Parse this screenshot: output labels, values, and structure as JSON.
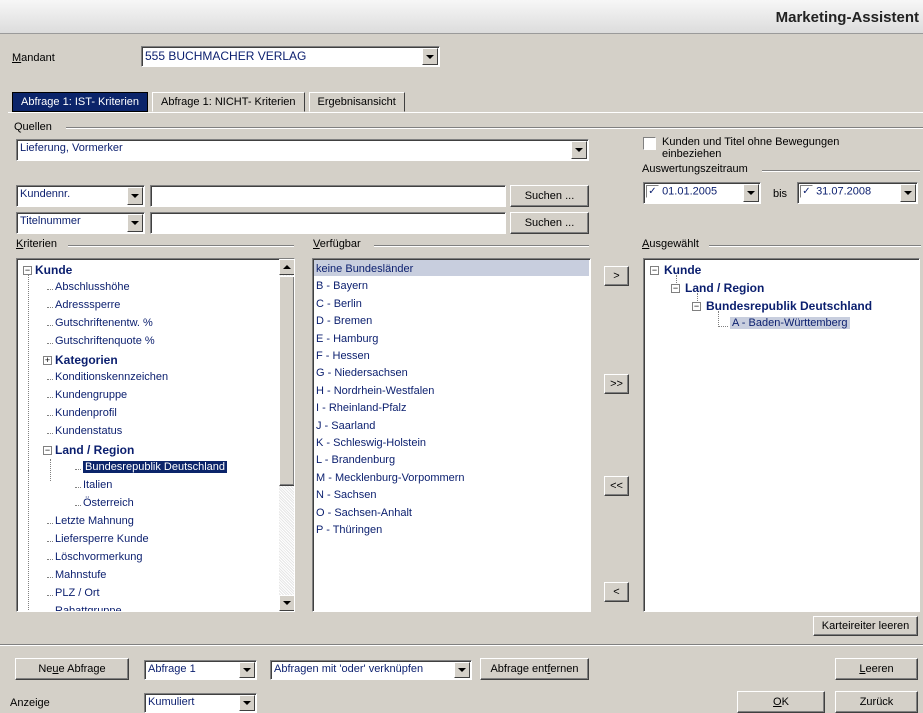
{
  "window": {
    "title": "Marketing-Assistent"
  },
  "mandant": {
    "label": "Mandant",
    "value": "555  BUCHMACHER VERLAG"
  },
  "tabs": [
    {
      "label": "Abfrage 1:  IST- Kriterien",
      "active": true
    },
    {
      "label": "Abfrage 1:  NICHT- Kriterien",
      "active": false
    },
    {
      "label": "Ergebnisansicht",
      "active": false
    }
  ],
  "quellen": {
    "label": "Quellen",
    "value": "Lieferung, Vormerker"
  },
  "options": {
    "no_movement_label": "Kunden und Titel ohne Bewegungen einbeziehen",
    "no_movement_checked": false,
    "period_label": "Auswertungszeitraum",
    "from_date": "01.01.2005",
    "to_label": "bis",
    "to_date": "31.07.2008",
    "from_checked": true,
    "to_checked": true
  },
  "search_rows": [
    {
      "field": "Kundennr.",
      "value": "",
      "button": "Suchen ..."
    },
    {
      "field": "Titelnummer",
      "value": "",
      "button": "Suchen ..."
    }
  ],
  "kriterien": {
    "label": "Kriterien",
    "items": [
      {
        "text": "Kunde",
        "level": 0,
        "bold": true,
        "expander": "−"
      },
      {
        "text": "Abschlusshöhe",
        "level": 1
      },
      {
        "text": "Adresssperre",
        "level": 1
      },
      {
        "text": "Gutschriftenentw. %",
        "level": 1
      },
      {
        "text": "Gutschriftenquote %",
        "level": 1
      },
      {
        "text": "Kategorien",
        "level": 1,
        "bold": true,
        "expander": "+"
      },
      {
        "text": "Konditionskennzeichen",
        "level": 1
      },
      {
        "text": "Kundengruppe",
        "level": 1
      },
      {
        "text": "Kundenprofil",
        "level": 1
      },
      {
        "text": "Kundenstatus",
        "level": 1
      },
      {
        "text": "Land / Region",
        "level": 1,
        "bold": true,
        "expander": "−"
      },
      {
        "text": "Bundesrepublik Deutschland",
        "level": 2,
        "selected": true
      },
      {
        "text": "Italien",
        "level": 2
      },
      {
        "text": "Österreich",
        "level": 2
      },
      {
        "text": "Letzte Mahnung",
        "level": 1
      },
      {
        "text": "Liefersperre Kunde",
        "level": 1
      },
      {
        "text": "Löschvormerkung",
        "level": 1
      },
      {
        "text": "Mahnstufe",
        "level": 1
      },
      {
        "text": "PLZ / Ort",
        "level": 1
      },
      {
        "text": "Rabattgruppe",
        "level": 1
      }
    ]
  },
  "verfuegbar": {
    "label": "Verfügbar",
    "items": [
      "keine Bundesländer",
      "B - Bayern",
      "C - Berlin",
      "D - Bremen",
      "E - Hamburg",
      "F - Hessen",
      "G - Niedersachsen",
      "H - Nordrhein-Westfalen",
      "I - Rheinland-Pfalz",
      "J - Saarland",
      "K - Schleswig-Holstein",
      "L - Brandenburg",
      "M - Mecklenburg-Vorpommern",
      "N - Sachsen",
      "O - Sachsen-Anhalt",
      "P - Thüringen"
    ]
  },
  "transfer": {
    "add": ">",
    "add_all": ">>",
    "remove_all": "<<",
    "remove": "<"
  },
  "ausgewaehlt": {
    "label": "Ausgewählt",
    "items": [
      {
        "text": "Kunde",
        "level": 0,
        "bold": true
      },
      {
        "text": "Land / Region",
        "level": 1,
        "bold": true
      },
      {
        "text": "Bundesrepublik Deutschland",
        "level": 2,
        "bold": true
      },
      {
        "text": "A - Baden-Württemberg",
        "level": 3,
        "selected": true
      }
    ],
    "clear_tab_button": "Karteireiter leeren"
  },
  "bottom": {
    "new_query": "Neue Abfrage",
    "query_select": "Abfrage 1",
    "join_select": "Abfragen mit 'oder' verknüpfen",
    "remove_query": "Abfrage entfernen",
    "clear": "Leeren",
    "display_label": "Anzeige",
    "display_select": "Kumuliert",
    "ok": "OK",
    "back": "Zurück"
  }
}
